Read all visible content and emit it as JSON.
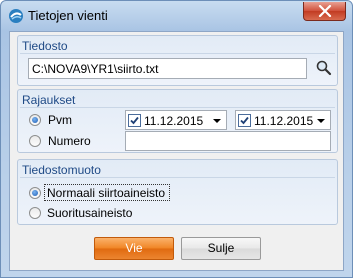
{
  "window": {
    "title": "Tietojen vienti",
    "icon": "app-logo-icon",
    "close_icon": "close-icon"
  },
  "file_group": {
    "title": "Tiedosto",
    "path_value": "C:\\NOVA9\\YR1\\siirto.txt",
    "search_icon": "search-icon"
  },
  "limits_group": {
    "title": "Rajaukset",
    "options": [
      {
        "label": "Pvm",
        "checked": true
      },
      {
        "label": "Numero",
        "checked": false
      }
    ],
    "date_from": {
      "value": "11.12.2015",
      "checked": true
    },
    "date_to": {
      "value": "11.12.2015",
      "checked": true
    },
    "number_value": ""
  },
  "format_group": {
    "title": "Tiedostomuoto",
    "options": [
      {
        "label": "Normaali siirtoaineisto",
        "checked": true
      },
      {
        "label": "Suoritusaineisto",
        "checked": false
      }
    ]
  },
  "buttons": {
    "export_label": "Vie",
    "close_label": "Sulje"
  },
  "colors": {
    "accent": "#f08423",
    "group_title": "#1f4a86"
  }
}
